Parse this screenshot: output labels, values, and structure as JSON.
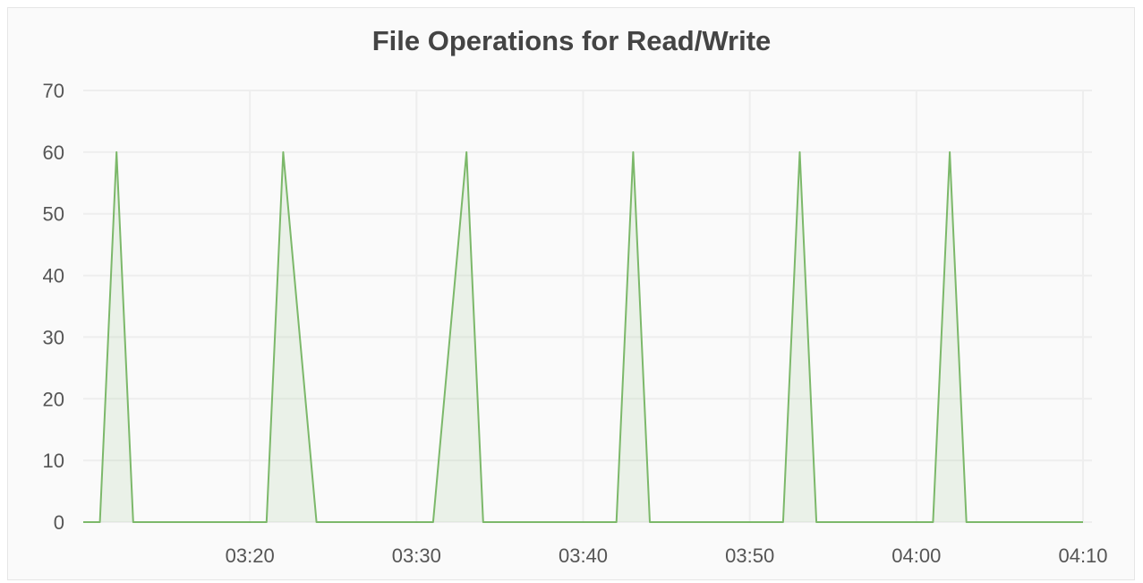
{
  "chart_data": {
    "type": "area",
    "title": "File Operations for Read/Write",
    "xlabel": "",
    "ylabel": "",
    "ylim": [
      0,
      70
    ],
    "yticks": [
      "0",
      "10",
      "20",
      "30",
      "40",
      "50",
      "60",
      "70"
    ],
    "xlim": [
      "03:10",
      "04:10"
    ],
    "xticks": [
      "03:20",
      "03:30",
      "03:40",
      "03:50",
      "04:00",
      "04:10"
    ],
    "grid": true,
    "legend": "none",
    "series": [
      {
        "color": "#7cb86a",
        "x": [
          "03:10",
          "03:11",
          "03:12",
          "03:13",
          "03:21",
          "03:22",
          "03:24",
          "03:31",
          "03:33",
          "03:34",
          "03:42",
          "03:43",
          "03:44",
          "03:52",
          "03:53",
          "03:54",
          "04:01",
          "04:02",
          "04:03",
          "04:10"
        ],
        "values": [
          0,
          0,
          60,
          0,
          0,
          60,
          0,
          0,
          60,
          0,
          0,
          60,
          0,
          0,
          60,
          0,
          0,
          60,
          0,
          0
        ]
      }
    ]
  }
}
